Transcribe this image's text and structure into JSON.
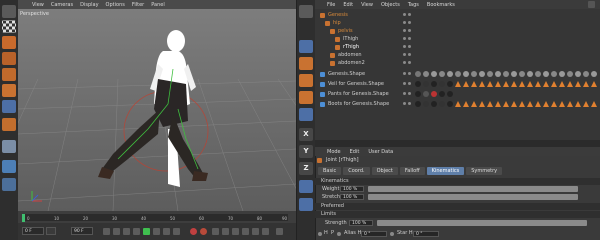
{
  "viewport": {
    "menu": [
      "View",
      "Cameras",
      "Display",
      "Options",
      "Filter",
      "Panel"
    ],
    "label": "Perspective"
  },
  "timeline": {
    "ticks": [
      "0",
      "10",
      "20",
      "30",
      "40",
      "50",
      "60",
      "70",
      "80",
      "90"
    ],
    "start_frame": "0 F",
    "current_frame": "0 F",
    "end_frame": "90 F",
    "max_frame": "90 F"
  },
  "left_toolbar": {
    "tools": [
      "undo-icon",
      "checker-icon",
      "cube-icon",
      "layers-icon",
      "rotate-icon",
      "grid-icon",
      "snap-icon",
      "magnet-icon"
    ]
  },
  "mid_toolbar": {
    "tools": [
      "cursor-icon",
      "move-icon",
      "scale-icon",
      "rotate-icon",
      "live-select-icon",
      "x-axis-icon",
      "y-axis-icon",
      "z-axis-icon",
      "coord-system-icon"
    ],
    "letters": [
      "X",
      "Y",
      "Z"
    ]
  },
  "object_manager": {
    "menu": [
      "File",
      "Edit",
      "View",
      "Objects",
      "Tags",
      "Bookmarks"
    ],
    "rows": [
      {
        "name": "Genesis",
        "indent": 0
      },
      {
        "name": "hip",
        "indent": 1
      },
      {
        "name": "pelvis",
        "indent": 2
      },
      {
        "name": "lThigh",
        "indent": 3
      },
      {
        "name": "rThigh",
        "indent": 3
      },
      {
        "name": "abdomen",
        "indent": 2
      },
      {
        "name": "abdomen2",
        "indent": 2
      },
      {
        "name": "Genesis.Shape",
        "indent": 0
      },
      {
        "name": "Veil for Genesis.Shape",
        "indent": 0
      },
      {
        "name": "Pants for Genesis.Shape",
        "indent": 0
      },
      {
        "name": "Boots for Genesis.Shape",
        "indent": 0
      }
    ]
  },
  "attribute_manager": {
    "menu": [
      "Mode",
      "Edit",
      "User Data"
    ],
    "title": "Joint [rThigh]",
    "tabs": [
      "Basic",
      "Coord.",
      "Object",
      "Falloff",
      "Kinematics",
      "Symmetry"
    ],
    "active_tab": "Kinematics",
    "section_kinematics": "Kinematics",
    "weight_label": "Weight",
    "weight_value": "100 %",
    "weight_pct": 1.0,
    "stretch_label": "Stretch",
    "stretch_value": "100 %",
    "stretch_pct": 1.0,
    "section_preferred": "Preferred",
    "section_limits": "Limits",
    "strength_label": "Strength",
    "strength_value": "100 %",
    "strength_pct": 1.0,
    "h_label": "H",
    "p_label": "P",
    "alias_h_label": "Alias H",
    "star_h_label": "Star H",
    "alias_h_value": "0 °",
    "star_h_value": "0 °"
  }
}
